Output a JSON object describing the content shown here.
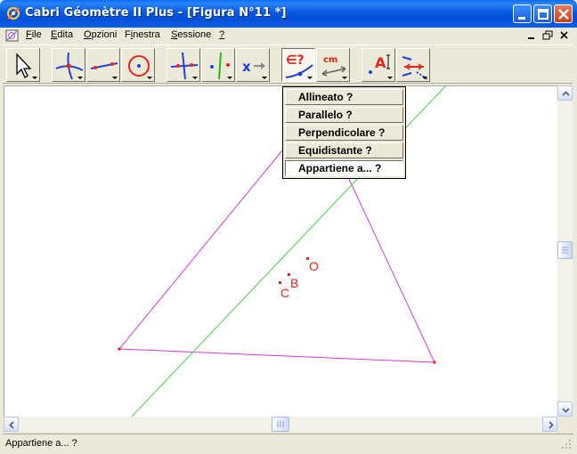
{
  "window": {
    "title": "Cabri Géomètre II Plus - [Figura N°11 *]",
    "controls": [
      "minimize",
      "maximize",
      "close"
    ]
  },
  "menubar": {
    "items": [
      {
        "label": "File",
        "accel": "F",
        "rest": "ile"
      },
      {
        "label": "Edita",
        "accel": "E",
        "rest": "dita"
      },
      {
        "label": "Opzioni",
        "accel": "O",
        "rest": "pzioni"
      },
      {
        "label": "Finestra",
        "accel": "i",
        "pre": "F",
        "rest": "nestra"
      },
      {
        "label": "Sessione",
        "accel": "S",
        "rest": "essione"
      },
      {
        "label": "?",
        "accel": "?",
        "rest": ""
      }
    ]
  },
  "toolbar": {
    "tools": [
      {
        "name": "pointer-tool",
        "icon": "arrow-pointer-icon"
      },
      {
        "name": "points-tool",
        "icon": "intersecting-curves-point-icon"
      },
      {
        "name": "lines-tool",
        "icon": "segment-icon"
      },
      {
        "name": "curves-tool",
        "icon": "circle-icon"
      },
      {
        "name": "construct-tool",
        "icon": "perpendicular-line-icon"
      },
      {
        "name": "transform-tool",
        "icon": "symmetry-icon"
      },
      {
        "name": "macro-tool",
        "icon": "macro-x-icon"
      },
      {
        "name": "check-property-tool",
        "icon": "member-check-icon",
        "label": "∈?",
        "active": true
      },
      {
        "name": "measure-tool",
        "icon": "measure-cm-icon",
        "label": "cm"
      },
      {
        "name": "display-tool",
        "icon": "text-label-icon",
        "label": "A"
      },
      {
        "name": "draw-tool",
        "icon": "marks-icon"
      }
    ]
  },
  "dropdown": {
    "items": [
      {
        "label": "Allineato ?",
        "selected": false
      },
      {
        "label": "Parallelo ?",
        "selected": false
      },
      {
        "label": "Perpendicolare ?",
        "selected": false
      },
      {
        "label": "Equidistante ?",
        "selected": false
      },
      {
        "label": "Appartiene a... ?",
        "selected": true
      }
    ]
  },
  "figure": {
    "points": [
      {
        "label": "O"
      },
      {
        "label": "B"
      },
      {
        "label": "C"
      }
    ],
    "colors": {
      "triangle": "#d63ad6",
      "line": "#46d246",
      "points": "#e8231a"
    }
  },
  "statusbar": {
    "text": "Appartiene a... ?"
  }
}
